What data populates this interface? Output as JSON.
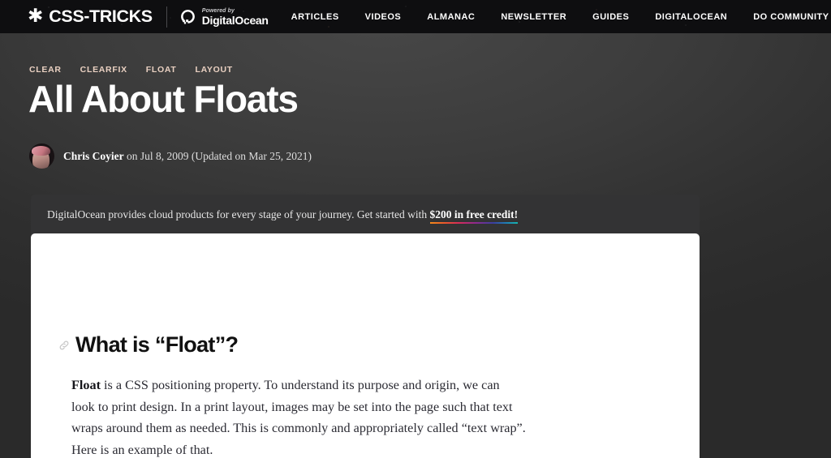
{
  "header": {
    "brand": {
      "star_icon": "asterisk-star-icon",
      "name": "CSS-TRICKS"
    },
    "sponsor": {
      "mark": "digitalocean-logo-icon",
      "powered_by": "Powered by",
      "name": "DigitalOcean"
    },
    "nav": [
      {
        "label": "ARTICLES"
      },
      {
        "label": "VIDEOS"
      },
      {
        "label": "ALMANAC"
      },
      {
        "label": "NEWSLETTER"
      },
      {
        "label": "GUIDES"
      },
      {
        "label": "DIGITALOCEAN"
      },
      {
        "label": "DO COMMUNITY"
      }
    ]
  },
  "article": {
    "tags": [
      {
        "label": "CLEAR"
      },
      {
        "label": "CLEARFIX"
      },
      {
        "label": "FLOAT"
      },
      {
        "label": "LAYOUT"
      }
    ],
    "title": "All About Floats",
    "byline": {
      "avatar": "author-avatar",
      "author": "Chris Coyier",
      "meta": " on Jul 8, 2009 (Updated on Mar 25, 2021)"
    }
  },
  "promo": {
    "text_before": "DigitalOcean provides cloud products for every stage of your journey. Get started with ",
    "offer": "$200 in free credit!"
  },
  "content": {
    "anchor_icon": "link-chain-icon",
    "heading": "What is “Float”?",
    "paragraph_lead": "Float",
    "paragraph_rest": " is a CSS positioning property. To understand its purpose and origin, we can look to print design. In a print layout, images may be set into the page such that text wraps around them as needed. This is commonly and appropriately called “text wrap”. Here is an example of that."
  },
  "colors": {
    "header_bg": "#0e0e10",
    "page_bg": "#2f2f2f",
    "banner_bg": "#333334",
    "card_bg": "#ffffff",
    "tag_color": "#e9d0c1",
    "accent_gradient_start": "#f38b1c",
    "accent_gradient_end": "#16b6b0"
  }
}
